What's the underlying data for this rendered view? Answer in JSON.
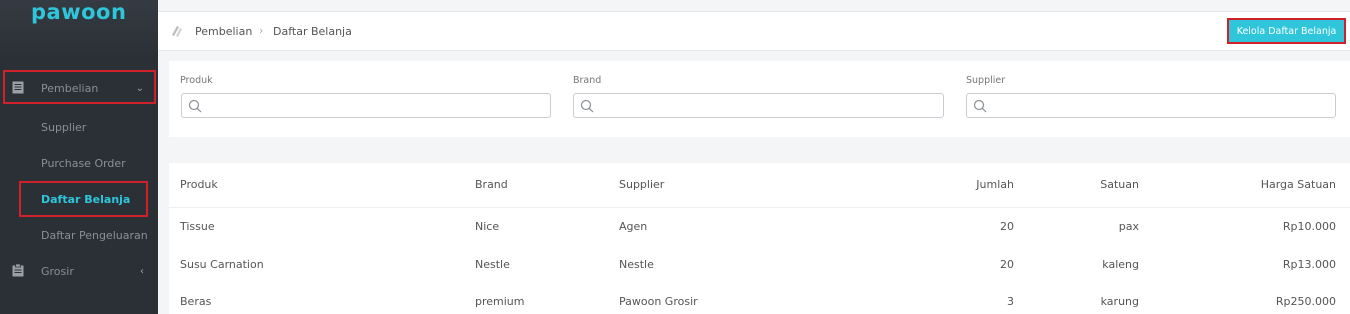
{
  "app": {
    "logo_text": "pawoon"
  },
  "sidebar": {
    "items": [
      {
        "label": "Pembelian",
        "icon": "document-icon",
        "expanded": true
      },
      {
        "label": "Supplier"
      },
      {
        "label": "Purchase Order"
      },
      {
        "label": "Daftar Belanja",
        "active": true
      },
      {
        "label": "Daftar Pengeluaran"
      },
      {
        "label": "Grosir",
        "icon": "clipboard-icon",
        "expanded": false
      }
    ]
  },
  "breadcrumb": {
    "items": [
      "Pembelian",
      "Daftar Belanja"
    ]
  },
  "header": {
    "action_label": "Kelola Daftar Belanja"
  },
  "filters": {
    "produk_label": "Produk",
    "brand_label": "Brand",
    "supplier_label": "Supplier"
  },
  "table": {
    "columns": [
      "Produk",
      "Brand",
      "Supplier",
      "Jumlah",
      "Satuan",
      "Harga Satuan"
    ],
    "rows": [
      [
        "Tissue",
        "Nice",
        "Agen",
        "20",
        "pax",
        "Rp10.000"
      ],
      [
        "Susu Carnation",
        "Nestle",
        "Nestle",
        "20",
        "kaleng",
        "Rp13.000"
      ],
      [
        "Beras",
        "premium",
        "Pawoon Grosir",
        "3",
        "karung",
        "Rp250.000"
      ]
    ]
  },
  "colors": {
    "accent": "#2fc6dc",
    "sidebar_bg": "#2b3036",
    "highlight": "#d0212b"
  }
}
